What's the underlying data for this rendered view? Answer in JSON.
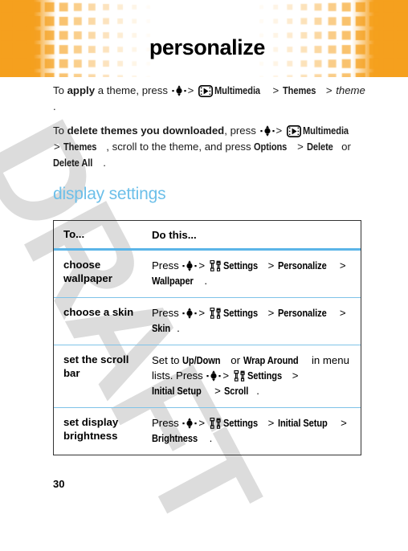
{
  "page": {
    "title": "personalize",
    "page_number": "30",
    "watermark": "DRAFT",
    "accent_blue": "#6cbfe9",
    "divider_blue": "#5bb5e8",
    "banner_orange": "#f5a01e",
    "banner_orange_light": "#fbc97a"
  },
  "paragraphs": [
    {
      "id": "apply-theme",
      "segments": [
        {
          "type": "text",
          "text": "To "
        },
        {
          "type": "bold",
          "text": "apply"
        },
        {
          "type": "text",
          "text": " a theme, press "
        },
        {
          "type": "icon",
          "icon": "nav-key-icon"
        },
        {
          "type": "gt",
          "text": ">"
        },
        {
          "type": "icon",
          "icon": "multimedia-icon"
        },
        {
          "type": "cond",
          "text": "Multimedia"
        },
        {
          "type": "gt",
          "text": ">"
        },
        {
          "type": "cond",
          "text": "Themes"
        },
        {
          "type": "gt",
          "text": ">"
        },
        {
          "type": "italic",
          "text": "theme"
        },
        {
          "type": "text",
          "text": "."
        }
      ]
    },
    {
      "id": "delete-themes",
      "segments": [
        {
          "type": "text",
          "text": "To "
        },
        {
          "type": "bold",
          "text": "delete themes you downloaded"
        },
        {
          "type": "text",
          "text": ", press "
        },
        {
          "type": "icon",
          "icon": "nav-key-icon"
        },
        {
          "type": "gt",
          "text": ">"
        },
        {
          "type": "icon",
          "icon": "multimedia-icon"
        },
        {
          "type": "cond",
          "text": "Multimedia"
        },
        {
          "type": "gt",
          "text": ">"
        },
        {
          "type": "cond",
          "text": "Themes"
        },
        {
          "type": "text",
          "text": ", scroll to the theme, and press "
        },
        {
          "type": "cond",
          "text": "Options"
        },
        {
          "type": "gt",
          "text": ">"
        },
        {
          "type": "cond",
          "text": "Delete"
        },
        {
          "type": "text",
          "text": " or "
        },
        {
          "type": "cond",
          "text": "Delete All"
        },
        {
          "type": "text",
          "text": "."
        }
      ]
    }
  ],
  "section": {
    "heading": "display settings"
  },
  "table": {
    "headers": {
      "to": "To...",
      "do": "Do this..."
    },
    "rows": [
      {
        "to": "choose wallpaper",
        "do_segments": [
          {
            "type": "text",
            "text": "Press "
          },
          {
            "type": "icon",
            "icon": "nav-key-icon"
          },
          {
            "type": "gt",
            "text": ">"
          },
          {
            "type": "icon",
            "icon": "settings-icon"
          },
          {
            "type": "cond",
            "text": "Settings"
          },
          {
            "type": "gt",
            "text": ">"
          },
          {
            "type": "cond",
            "text": "Personalize"
          },
          {
            "type": "gt",
            "text": ">"
          },
          {
            "type": "cond",
            "text": "Wallpaper"
          },
          {
            "type": "text",
            "text": "."
          }
        ]
      },
      {
        "to": "choose a skin",
        "do_segments": [
          {
            "type": "text",
            "text": "Press "
          },
          {
            "type": "icon",
            "icon": "nav-key-icon"
          },
          {
            "type": "gt",
            "text": ">"
          },
          {
            "type": "icon",
            "icon": "settings-icon"
          },
          {
            "type": "cond",
            "text": "Settings"
          },
          {
            "type": "gt",
            "text": ">"
          },
          {
            "type": "cond",
            "text": "Personalize"
          },
          {
            "type": "gt",
            "text": ">"
          },
          {
            "type": "cond",
            "text": "Skin"
          },
          {
            "type": "text",
            "text": "."
          }
        ]
      },
      {
        "to": "set the scroll bar",
        "do_segments": [
          {
            "type": "text",
            "text": "Set to "
          },
          {
            "type": "cond",
            "text": "Up/Down"
          },
          {
            "type": "text",
            "text": " or "
          },
          {
            "type": "cond",
            "text": "Wrap Around"
          },
          {
            "type": "text",
            "text": " in menu lists. Press "
          },
          {
            "type": "icon",
            "icon": "nav-key-icon"
          },
          {
            "type": "gt",
            "text": ">"
          },
          {
            "type": "icon",
            "icon": "settings-icon"
          },
          {
            "type": "cond",
            "text": "Settings"
          },
          {
            "type": "gt",
            "text": ">"
          },
          {
            "type": "cond",
            "text": "Initial Setup"
          },
          {
            "type": "gt",
            "text": ">"
          },
          {
            "type": "cond",
            "text": "Scroll"
          },
          {
            "type": "text",
            "text": "."
          }
        ]
      },
      {
        "to": "set display brightness",
        "do_segments": [
          {
            "type": "text",
            "text": "Press "
          },
          {
            "type": "icon",
            "icon": "nav-key-icon"
          },
          {
            "type": "gt",
            "text": ">"
          },
          {
            "type": "icon",
            "icon": "settings-icon"
          },
          {
            "type": "cond",
            "text": "Settings"
          },
          {
            "type": "gt",
            "text": ">"
          },
          {
            "type": "cond",
            "text": "Initial Setup"
          },
          {
            "type": "gt",
            "text": ">"
          },
          {
            "type": "cond",
            "text": "Brightness"
          },
          {
            "type": "text",
            "text": "."
          }
        ]
      }
    ]
  }
}
